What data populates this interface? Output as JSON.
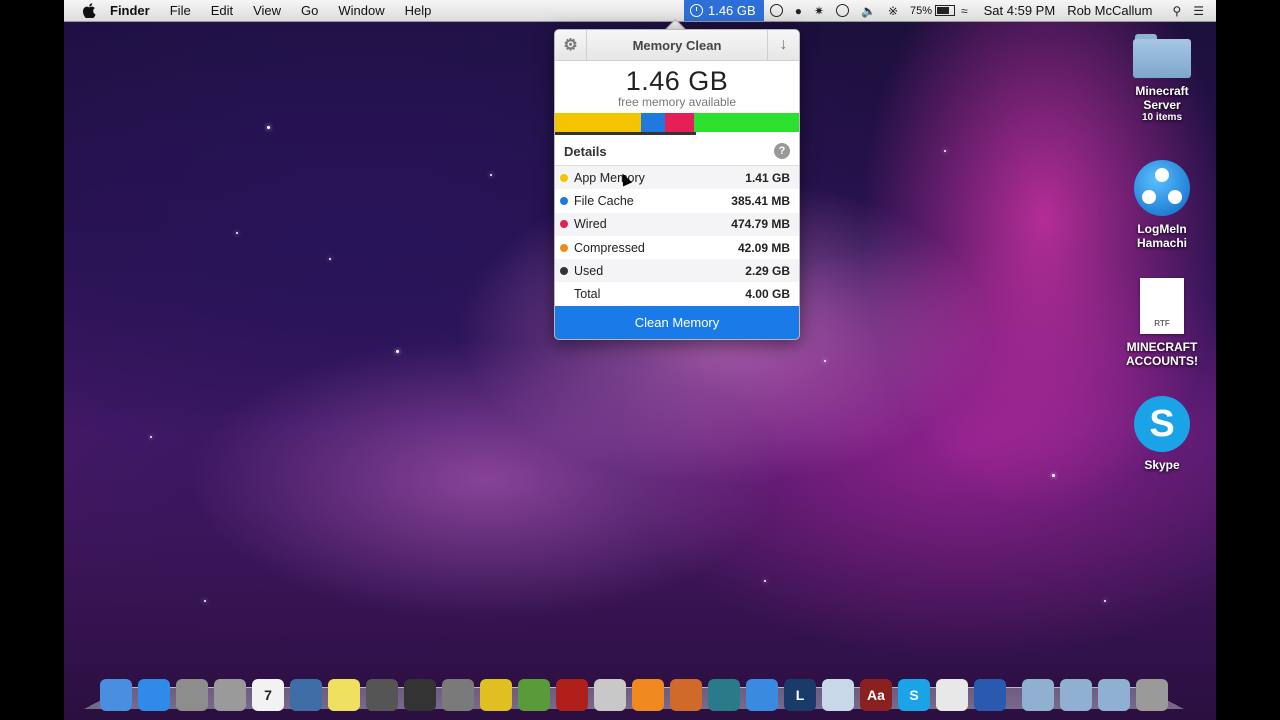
{
  "menubar": {
    "app_name": "Finder",
    "menus": [
      "File",
      "Edit",
      "View",
      "Go",
      "Window",
      "Help"
    ],
    "memory_status": "1.46 GB",
    "battery": "75%",
    "clock": "Sat 4:59 PM",
    "user": "Rob McCallum"
  },
  "popover": {
    "title": "Memory Clean",
    "free_amount": "1.46 GB",
    "free_label": "free memory available",
    "bar_colors": [
      "#f5c400",
      "#1f7ae0",
      "#e41f55",
      "#2ee02e"
    ],
    "bar_fractions": [
      0.353,
      0.096,
      0.119,
      0.432
    ],
    "details_label": "Details",
    "help": "?",
    "rows": [
      {
        "label": "App Memory",
        "value": "1.41 GB",
        "color": "#f5c400"
      },
      {
        "label": "File Cache",
        "value": "385.41 MB",
        "color": "#1f7ae0"
      },
      {
        "label": "Wired",
        "value": "474.79 MB",
        "color": "#e41f55"
      },
      {
        "label": "Compressed",
        "value": "42.09 MB",
        "color": "#f08a1a"
      },
      {
        "label": "Used",
        "value": "2.29 GB",
        "color": "#333333"
      },
      {
        "label": "Total",
        "value": "4.00 GB",
        "color": ""
      }
    ],
    "clean_button": "Clean Memory"
  },
  "desktop_icons": [
    {
      "label": "Minecraft\nServer",
      "sub": "10 items",
      "icon": "folder-icon"
    },
    {
      "label": "LogMeIn\nHamachi",
      "sub": "",
      "icon": "hamachi-icon"
    },
    {
      "label": "MINECRAFT\nACCOUNTS!",
      "sub": "",
      "icon": "rtf-document-icon",
      "badge": "RTF"
    },
    {
      "label": "Skype",
      "sub": "",
      "icon": "skype-icon",
      "glyph": "S"
    }
  ],
  "dock_apps": [
    {
      "name": "finder-icon",
      "color": "#4a8ee0"
    },
    {
      "name": "app-store-icon",
      "color": "#2f8ae8"
    },
    {
      "name": "launchpad-icon",
      "color": "#8d8d8d"
    },
    {
      "name": "system-preferences-icon",
      "color": "#9a9a9a"
    },
    {
      "name": "calendar-icon",
      "color": "#f2f2f2",
      "text": "7"
    },
    {
      "name": "preview-icon",
      "color": "#3f6ea6"
    },
    {
      "name": "stickies-icon",
      "color": "#f0e060"
    },
    {
      "name": "photo-booth-icon",
      "color": "#555555"
    },
    {
      "name": "dashboard-icon",
      "color": "#333333"
    },
    {
      "name": "facetime-icon",
      "color": "#7a7a7a"
    },
    {
      "name": "chrome-icon",
      "color": "#e0c020"
    },
    {
      "name": "minecraft-icon",
      "color": "#5a9a38"
    },
    {
      "name": "photo-booth-red-icon",
      "color": "#b0201a"
    },
    {
      "name": "automator-icon",
      "color": "#c8c8c8"
    },
    {
      "name": "ibooks-icon",
      "color": "#f08a20"
    },
    {
      "name": "game-center-icon",
      "color": "#d06a2a"
    },
    {
      "name": "time-machine-icon",
      "color": "#2b7a8a"
    },
    {
      "name": "itunes-icon",
      "color": "#3a8ae0"
    },
    {
      "name": "league-of-legends-icon",
      "color": "#1a3a6a",
      "text": "L"
    },
    {
      "name": "iphoto-icon",
      "color": "#c8d8e8"
    },
    {
      "name": "dictionary-icon",
      "color": "#8a2020",
      "text": "Aa"
    },
    {
      "name": "skype-dock-icon",
      "color": "#1aa3e6",
      "text": "S"
    },
    {
      "name": "textedit-icon",
      "color": "#e8e8e8"
    },
    {
      "name": "quicktime-icon",
      "color": "#2a5ab0"
    }
  ],
  "dock_right": [
    {
      "name": "downloads-stack-icon",
      "color": "#8fb0d0"
    },
    {
      "name": "applications-stack-icon",
      "color": "#8fb0d0"
    },
    {
      "name": "documents-stack-icon",
      "color": "#8fb0d0"
    },
    {
      "name": "trash-icon",
      "color": "#9a9a9a"
    }
  ]
}
